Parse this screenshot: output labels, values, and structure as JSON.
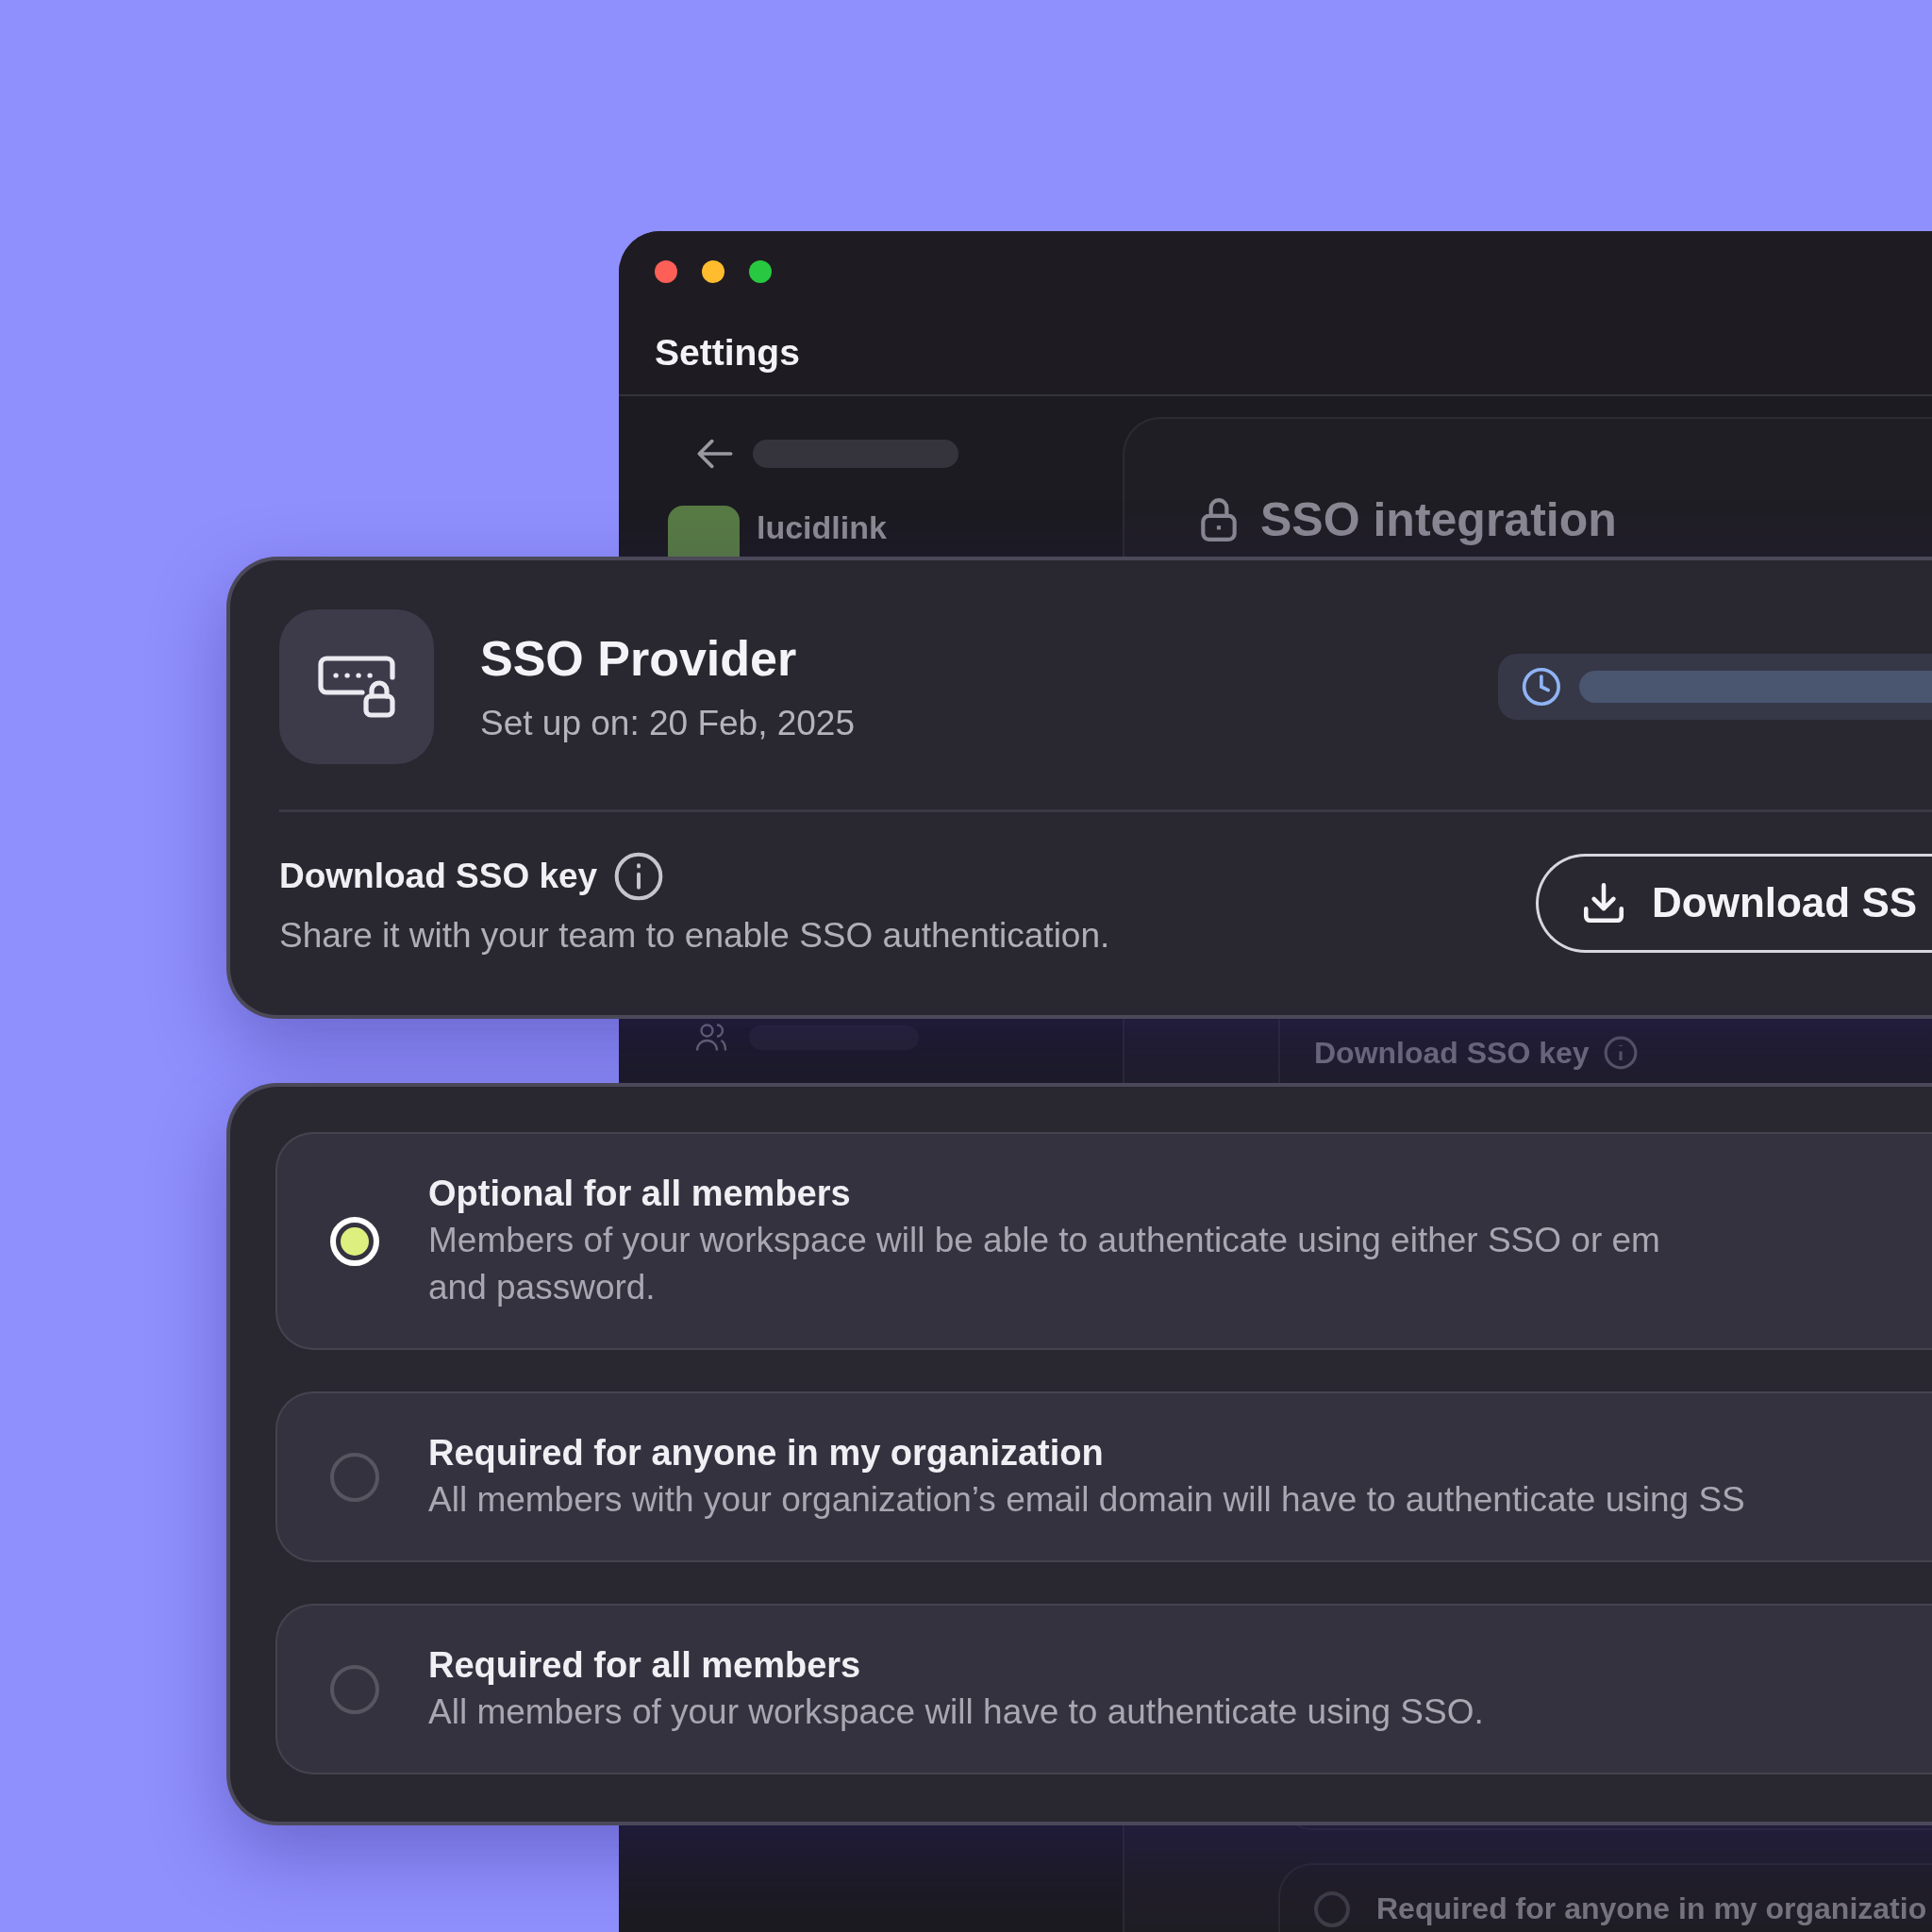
{
  "window": {
    "title": "Settings",
    "sidebar": {
      "workspace": "lucidlink"
    },
    "main": {
      "title": "SSO integration",
      "background_label": "Download SSO key",
      "background_option": {
        "title": "Required for anyone in my organizatio",
        "selected": false
      }
    }
  },
  "provider_card": {
    "title": "SSO Provider",
    "subtitle": "Set up on: 20 Feb, 2025",
    "download_label": "Download SSO key",
    "download_description": "Share it with your team to enable SSO authentication.",
    "button": "Download SS"
  },
  "options": [
    {
      "title": "Optional for all members",
      "description_lines": [
        "Members of your workspace will be able to authenticate using either SSO or em",
        "and password."
      ],
      "selected": true
    },
    {
      "title": "Required for anyone in my organization",
      "description_lines": [
        "All members with your organization’s email domain will have to authenticate using SS"
      ],
      "selected": false
    },
    {
      "title": "Required for all members",
      "description_lines": [
        "All members of your workspace will have to authenticate using SSO."
      ],
      "selected": false
    }
  ]
}
